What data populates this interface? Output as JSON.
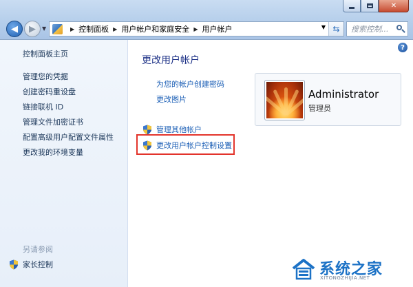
{
  "window": {
    "caption_min": "",
    "caption_max": "",
    "caption_close": "✕"
  },
  "address": {
    "crumbs": [
      "控制面板",
      "用户帐户和家庭安全",
      "用户帐户"
    ],
    "search_placeholder": "搜索控制..."
  },
  "left_pane": {
    "home": "控制面板主页",
    "links": [
      "管理您的凭据",
      "创建密码重设盘",
      "链接联机 ID",
      "管理文件加密证书",
      "配置高级用户配置文件属性",
      "更改我的环境变量"
    ],
    "see_also": "另请参阅",
    "parental_controls": "家长控制"
  },
  "main": {
    "heading": "更改用户帐户",
    "tasks": [
      "为您的帐户创建密码",
      "更改图片",
      "管理其他帐户",
      "更改用户帐户控制设置"
    ],
    "help": "?"
  },
  "user": {
    "name": "Administrator",
    "role": "管理员"
  },
  "watermark": {
    "title": "系统之家",
    "url": "XITONGZHIJIA.NET"
  },
  "colors": {
    "link": "#1c5fb6",
    "heading": "#1e3287",
    "highlight": "#e3342b"
  }
}
